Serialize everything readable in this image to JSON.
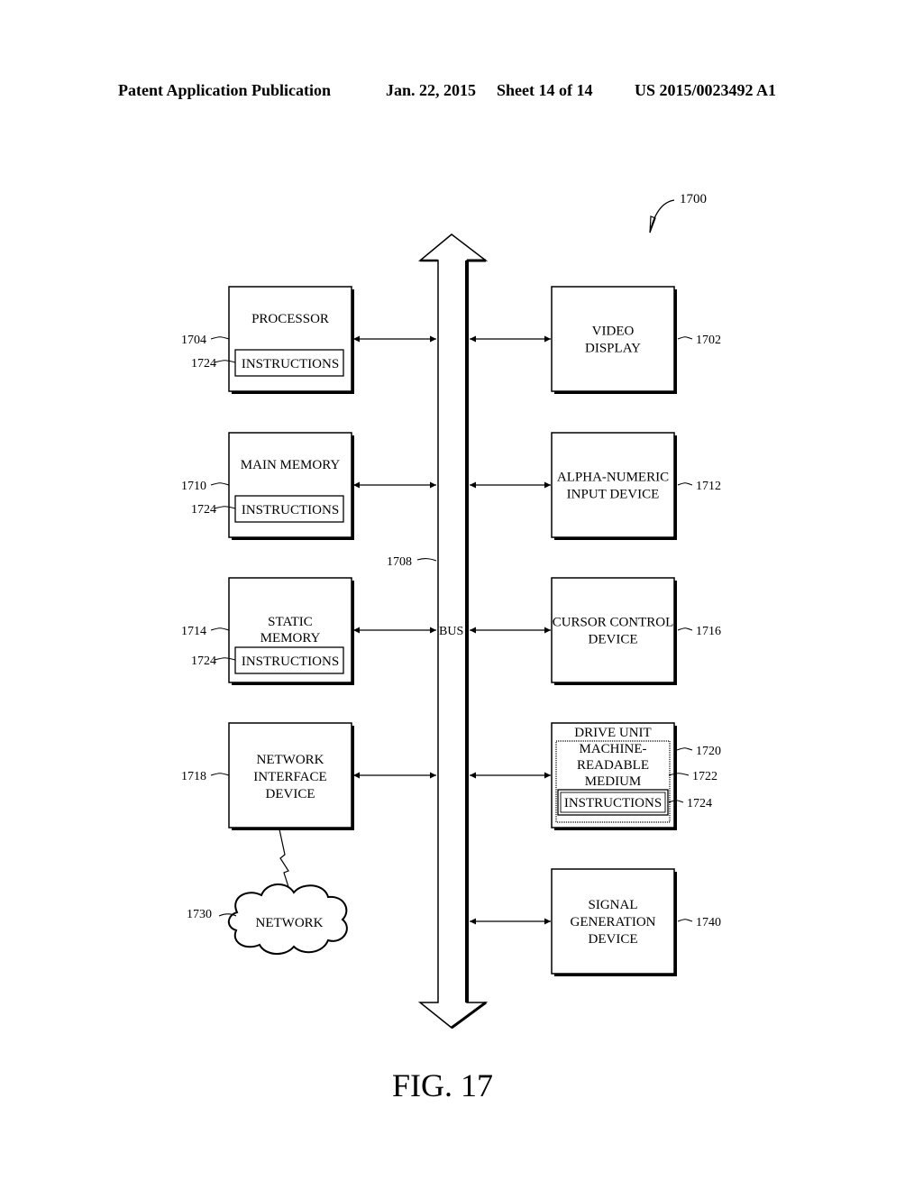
{
  "header": {
    "publication": "Patent Application Publication",
    "date": "Jan. 22, 2015",
    "sheet": "Sheet 14 of 14",
    "number": "US 2015/0023492 A1"
  },
  "figure": {
    "ref": "1700",
    "caption": "FIG. 17",
    "bus": {
      "label": "BUS",
      "ref": "1708"
    },
    "left_blocks": [
      {
        "id": "processor",
        "lines": [
          "PROCESSOR"
        ],
        "ref": "1704",
        "inner": "INSTRUCTIONS",
        "inner_ref": "1724"
      },
      {
        "id": "main-memory",
        "lines": [
          "MAIN MEMORY"
        ],
        "ref": "1710",
        "inner": "INSTRUCTIONS",
        "inner_ref": "1724"
      },
      {
        "id": "static-memory",
        "lines": [
          "STATIC",
          "MEMORY"
        ],
        "ref": "1714",
        "inner": "INSTRUCTIONS",
        "inner_ref": "1724"
      },
      {
        "id": "network-interface",
        "lines": [
          "NETWORK",
          "INTERFACE",
          "DEVICE"
        ],
        "ref": "1718"
      }
    ],
    "right_blocks": [
      {
        "id": "video-display",
        "lines": [
          "VIDEO",
          "DISPLAY"
        ],
        "ref": "1702"
      },
      {
        "id": "alpha-numeric-input",
        "lines": [
          "ALPHA-NUMERIC",
          "INPUT DEVICE"
        ],
        "ref": "1712"
      },
      {
        "id": "cursor-control",
        "lines": [
          "CURSOR CONTROL",
          "DEVICE"
        ],
        "ref": "1716"
      },
      {
        "id": "drive-unit",
        "lines": [
          "DRIVE UNIT"
        ],
        "ref": "1720",
        "medium": {
          "lines": [
            "MACHINE-",
            "READABLE",
            "MEDIUM"
          ],
          "ref": "1722"
        },
        "inner": "INSTRUCTIONS",
        "inner_ref": "1724"
      },
      {
        "id": "signal-generation",
        "lines": [
          "SIGNAL",
          "GENERATION",
          "DEVICE"
        ],
        "ref": "1740"
      }
    ],
    "network": {
      "label": "NETWORK",
      "ref": "1730"
    }
  }
}
